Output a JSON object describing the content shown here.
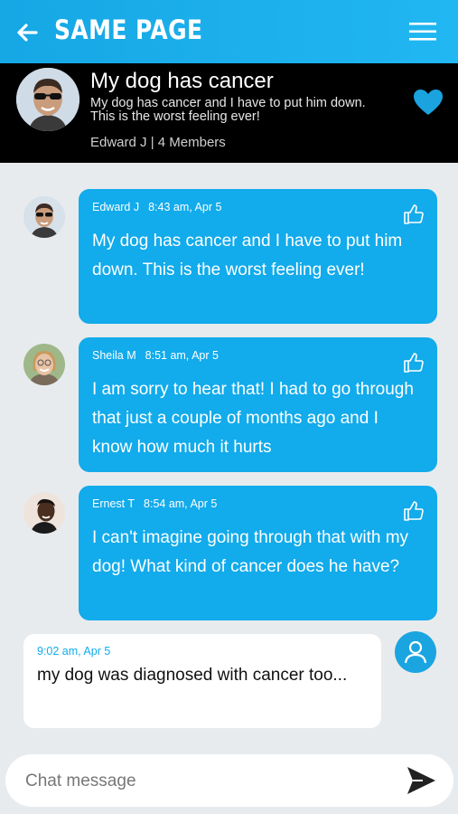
{
  "app_bar": {
    "title": "SAME PAGE",
    "back_icon": "arrow-left-icon",
    "menu_icon": "hamburger-menu-icon"
  },
  "group": {
    "title": "My dog has cancer",
    "description": "My dog has cancer and I have to put him down. This is the worst feeling ever!",
    "meta": "Edward J | 4 Members",
    "favorite_icon": "heart-icon",
    "favorite_color": "#1aa3de"
  },
  "messages": [
    {
      "author": "Edward J",
      "time": "8:43 am, Apr 5",
      "text": "My dog has cancer and I have to put him down. This is the worst feeling ever!",
      "like_icon": "thumbs-up-icon"
    },
    {
      "author": "Sheila M",
      "time": "8:51 am, Apr 5",
      "text": "I am sorry to hear that! I had to go through that just a couple of months ago and I know how much it hurts",
      "like_icon": "thumbs-up-icon"
    },
    {
      "author": "Ernest T",
      "time": "8:54 am, Apr 5",
      "text": "I can't imagine going through that with my dog! What kind of cancer does he have?",
      "like_icon": "thumbs-up-icon"
    }
  ],
  "own_message": {
    "time": "9:02 am, Apr 5",
    "text": "my dog was diagnosed with cancer too...",
    "avatar_icon": "user-icon"
  },
  "composer": {
    "placeholder": "Chat message",
    "value": "",
    "send_icon": "send-icon"
  },
  "colors": {
    "accent": "#12abeb",
    "background": "#e8ebee",
    "header_bg": "#000000"
  }
}
